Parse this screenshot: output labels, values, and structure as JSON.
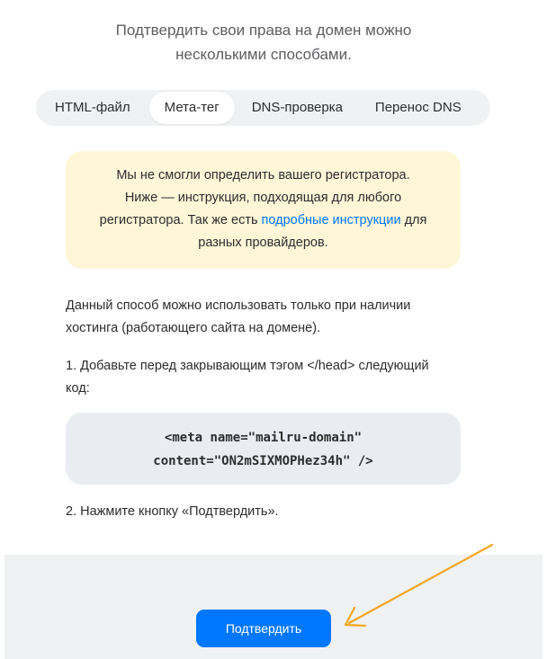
{
  "intro": {
    "line1": "Подтвердить свои права на домен можно",
    "line2": "несколькими способами."
  },
  "tabs": [
    {
      "label": "HTML-файл",
      "active": false
    },
    {
      "label": "Мета-тег",
      "active": true
    },
    {
      "label": "DNS-проверка",
      "active": false
    },
    {
      "label": "Перенос DNS",
      "active": false
    }
  ],
  "notice": {
    "line1": "Мы не смогли определить вашего регистратора.",
    "line2": "Ниже — инструкция, подходящая для любого",
    "line3_before": "регистратора. Так же есть ",
    "line3_link": "подробные инструкции",
    "line3_after": " для",
    "line4": "разных провайдеров."
  },
  "body": {
    "p1_line1": "Данный способ можно использовать только при наличии",
    "p1_line2": "хостинга (работающего сайта на домене).",
    "step1_line1": "1. Добавьте перед закрывающим тэгом </head> следующий",
    "step1_line2": "код:",
    "code_line1": "<meta name=\"mailru-domain\"",
    "code_line2": "content=\"ON2mSIXMOPHez34h\" />",
    "step2": "2. Нажмите кнопку «Подтвердить»."
  },
  "footer": {
    "confirm_label": "Подтвердить"
  },
  "colors": {
    "accent": "#0077ff",
    "notice_bg": "#fff6d8",
    "code_bg": "#e9ecf1",
    "tabs_bg": "#f0f1f3",
    "annotation_arrow": "#f5a623"
  }
}
